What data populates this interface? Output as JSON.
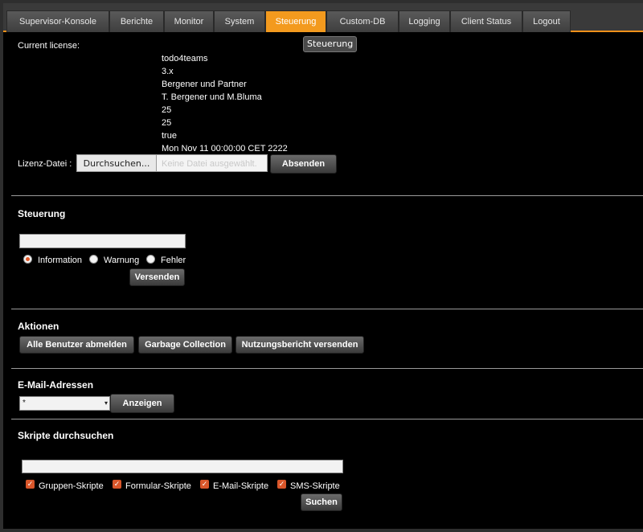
{
  "tabs": [
    "Supervisor-Konsole",
    "Berichte",
    "Monitor",
    "System",
    "Steuerung",
    "Custom-DB",
    "Logging",
    "Client Status",
    "Logout"
  ],
  "tooltip": "Steuerung",
  "license": {
    "label": "Current license:",
    "values": [
      "todo4teams",
      "3.x",
      "Bergener und Partner",
      "T. Bergener und M.Bluma",
      "25",
      "25",
      "true",
      "Mon Nov 11 00:00:00 CET 2222"
    ],
    "file_label": "Lizenz-Datei :",
    "browse_button": "Durchsuchen...",
    "no_file_text": "Keine Datei ausgewählt.",
    "submit_button": "Absenden"
  },
  "steuerung": {
    "title": "Steuerung",
    "message_value": "",
    "radios": [
      {
        "label": "Information",
        "checked": true
      },
      {
        "label": "Warnung",
        "checked": false
      },
      {
        "label": "Fehler",
        "checked": false
      }
    ],
    "send_button": "Versenden"
  },
  "aktionen": {
    "title": "Aktionen",
    "buttons": [
      "Alle Benutzer abmelden",
      "Garbage Collection",
      "Nutzungsbericht versenden"
    ]
  },
  "email": {
    "title": "E-Mail-Adressen",
    "select_value": "*",
    "show_button": "Anzeigen"
  },
  "skripte": {
    "title": "Skripte durchsuchen",
    "search_value": "",
    "checkboxes": [
      {
        "label": "Gruppen-Skripte",
        "checked": true
      },
      {
        "label": "Formular-Skripte",
        "checked": true
      },
      {
        "label": "E-Mail-Skripte",
        "checked": true
      },
      {
        "label": "SMS-Skripte",
        "checked": true
      }
    ],
    "search_button": "Suchen"
  },
  "colors": {
    "accent": "#f39a1e",
    "radio_check": "#e25a2a"
  }
}
